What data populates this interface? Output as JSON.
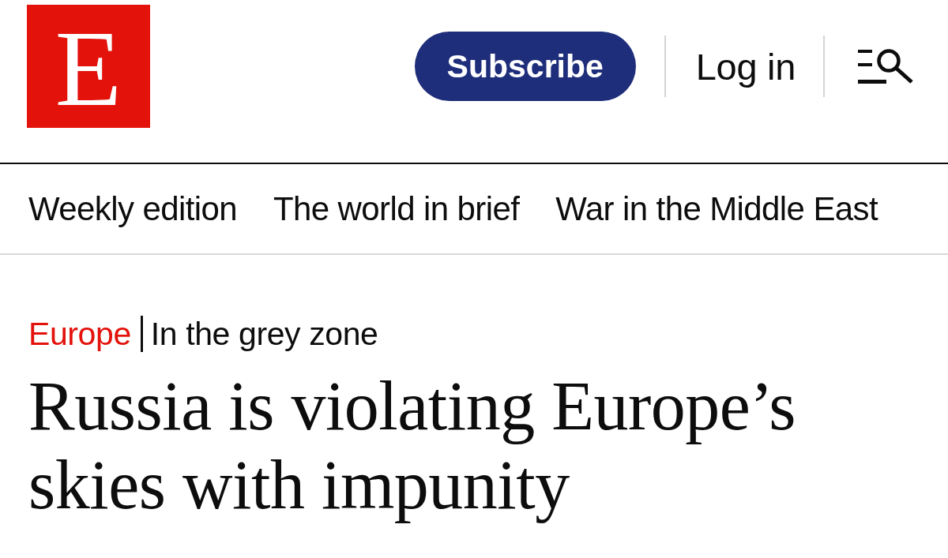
{
  "masthead": {
    "logo_letter": "E",
    "subscribe_button": "Subscribe",
    "login_link": "Log in"
  },
  "nav": {
    "items": [
      "Weekly edition",
      "The world in brief",
      "War in the Middle East"
    ]
  },
  "article": {
    "rubric": "Europe",
    "flytitle": "In the grey zone",
    "headline": "Russia is violating Europe’s skies with impunity"
  }
}
